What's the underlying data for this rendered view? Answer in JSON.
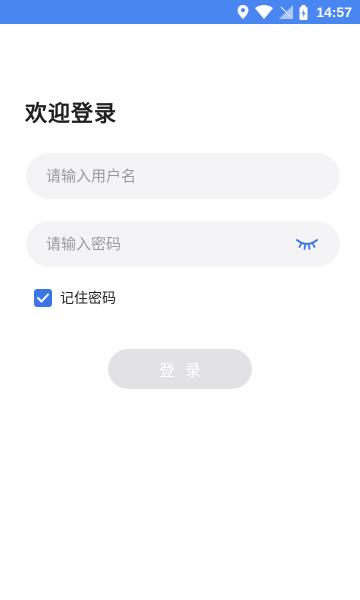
{
  "status_bar": {
    "time": "14:57",
    "icons": [
      "location-icon",
      "wifi-icon",
      "signal-icon",
      "battery-icon"
    ],
    "background_color": "#4a86f2"
  },
  "login": {
    "title": "欢迎登录",
    "username_placeholder": "请输入用户名",
    "username_value": "",
    "password_placeholder": "请输入密码",
    "password_value": "",
    "password_toggle_icon": "eye-closed-icon",
    "remember_label": "记住密码",
    "remember_checked": true,
    "submit_label": "登录",
    "accent_color": "#3a76e8"
  }
}
